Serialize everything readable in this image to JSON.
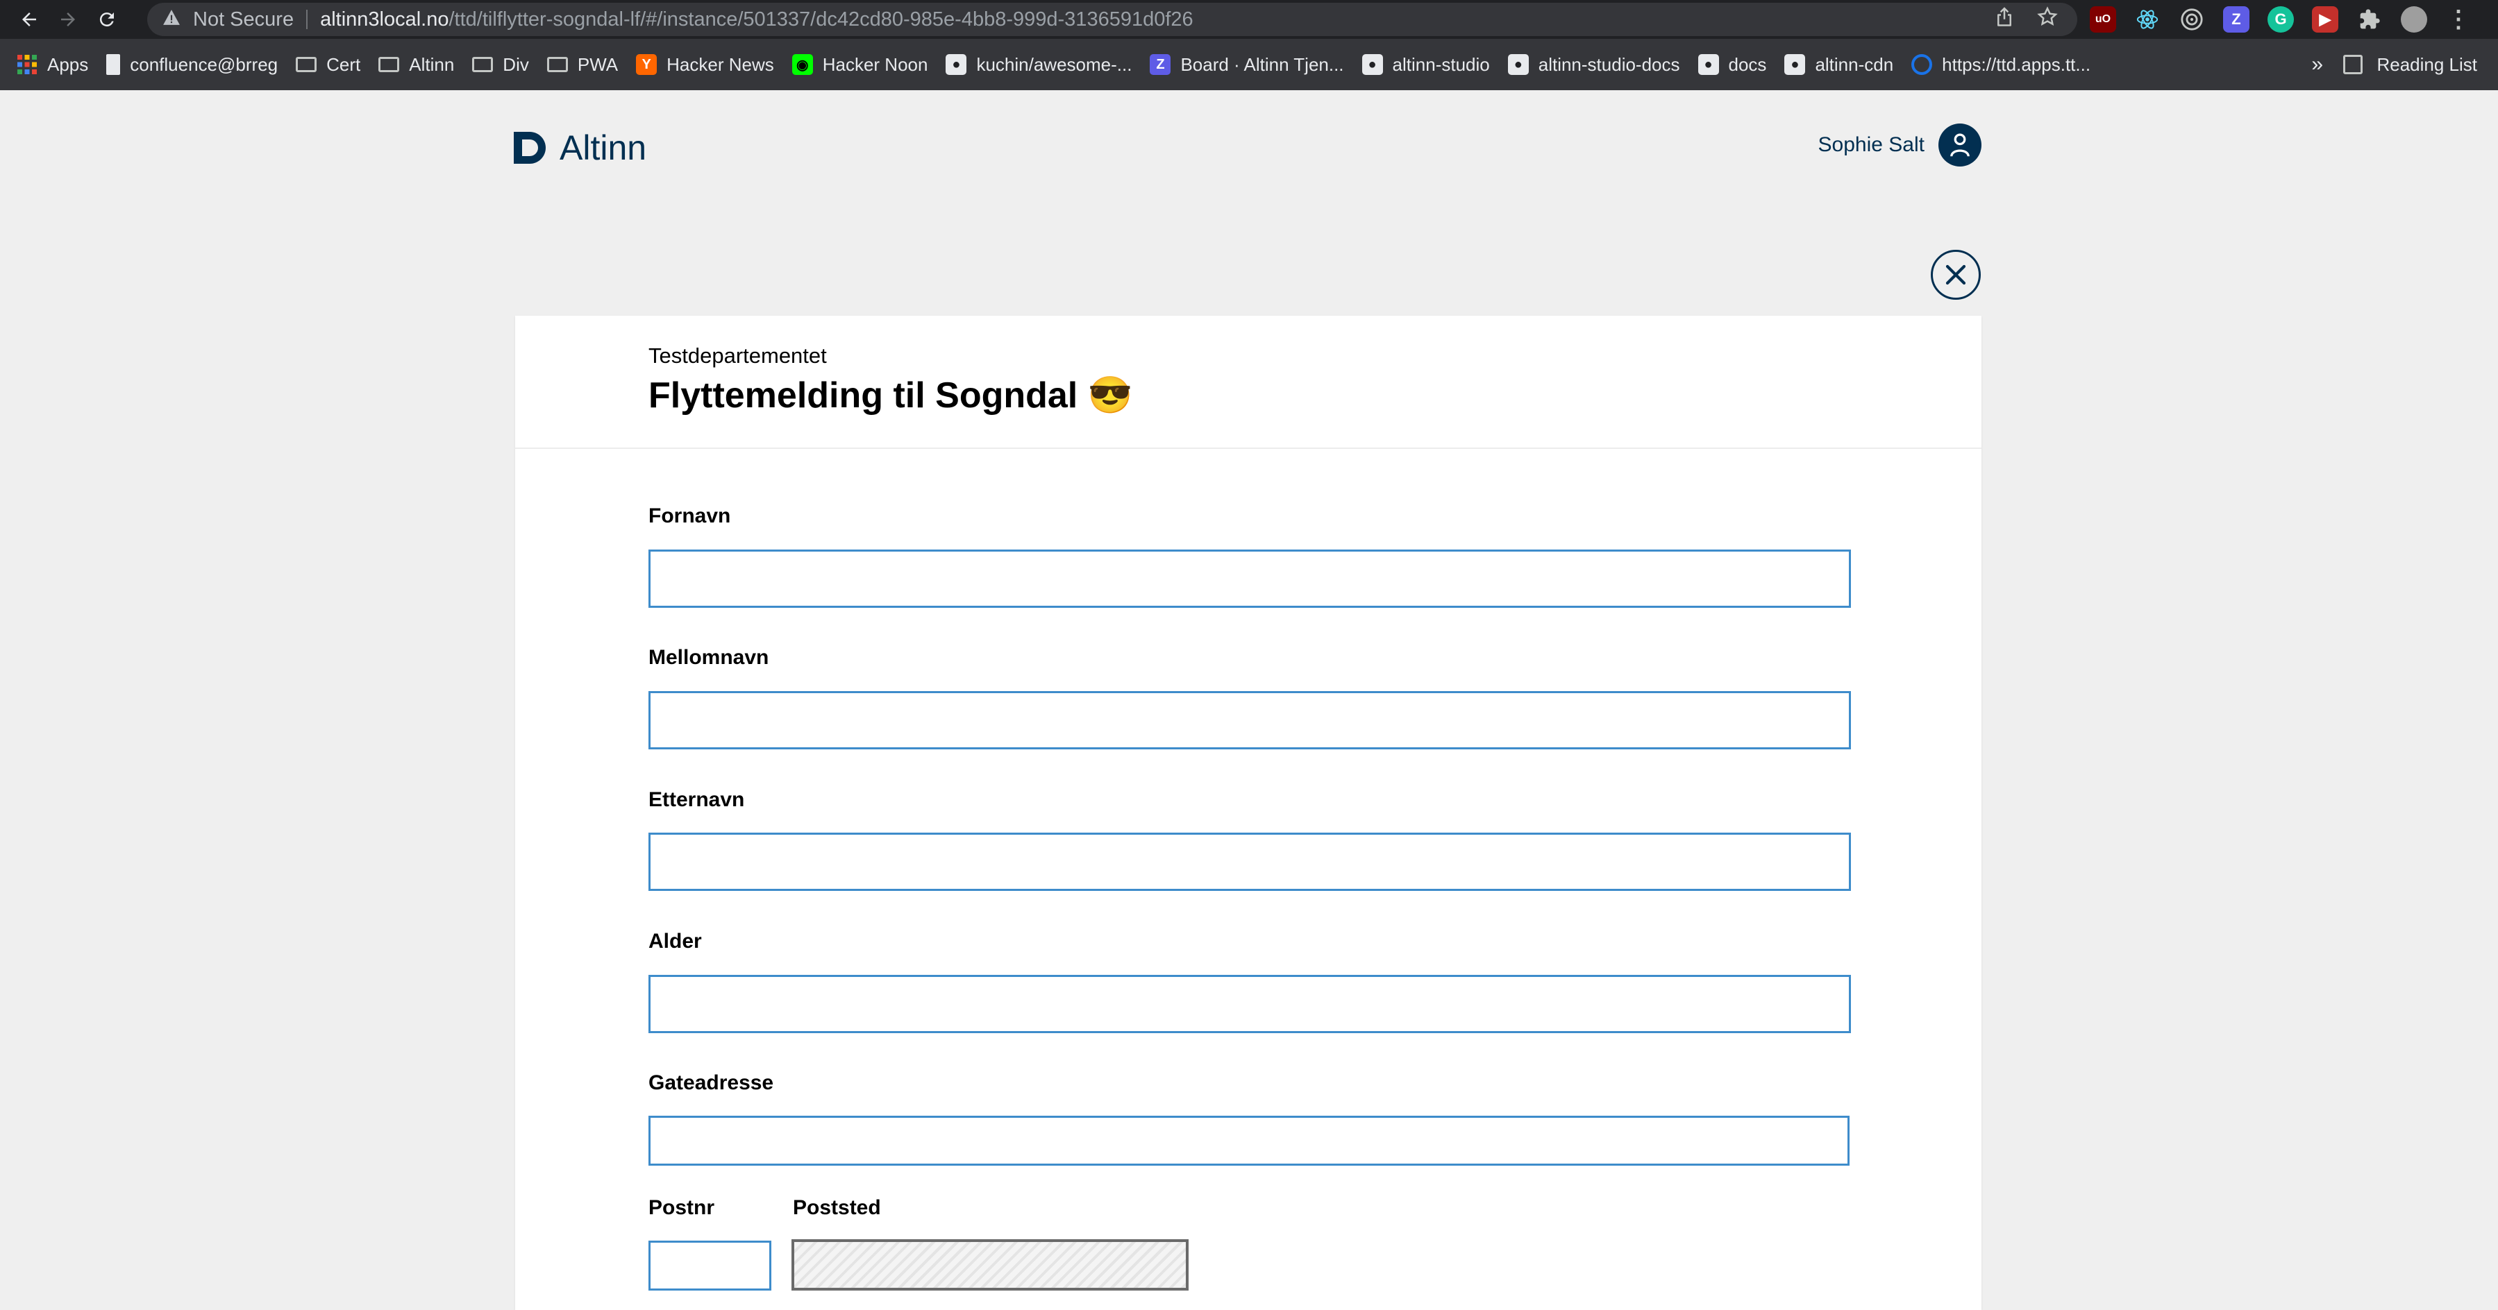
{
  "browser": {
    "security_text": "Not Secure",
    "url_host": "altinn3local.no",
    "url_path": "/ttd/tilflytter-sogndal-lf/#/instance/501337/dc42cd80-985e-4bb8-999d-3136591d0f26",
    "bookmarks": [
      {
        "label": "Apps",
        "icon": "apps-grid-icon"
      },
      {
        "label": "confluence@brreg",
        "icon": "page-icon"
      },
      {
        "label": "Cert",
        "icon": "folder-icon"
      },
      {
        "label": "Altinn",
        "icon": "folder-icon"
      },
      {
        "label": "Div",
        "icon": "folder-icon"
      },
      {
        "label": "PWA",
        "icon": "folder-icon"
      },
      {
        "label": "Hacker News",
        "icon": "hacker-news-icon"
      },
      {
        "label": "Hacker Noon",
        "icon": "hacker-noon-icon"
      },
      {
        "label": "kuchin/awesome-...",
        "icon": "github-icon"
      },
      {
        "label": "Board · Altinn Tjen...",
        "icon": "zenhub-icon"
      },
      {
        "label": "altinn-studio",
        "icon": "github-icon"
      },
      {
        "label": "altinn-studio-docs",
        "icon": "github-icon"
      },
      {
        "label": "docs",
        "icon": "github-icon"
      },
      {
        "label": "altinn-cdn",
        "icon": "github-icon"
      },
      {
        "label": "https://ttd.apps.tt...",
        "icon": "altinn-icon"
      }
    ],
    "overflow": "»",
    "reading_list": "Reading List",
    "colors": {
      "chrome_dark": "#202124",
      "toolbar": "#35363a"
    }
  },
  "header": {
    "logo_text": "Altinn",
    "user_name": "Sophie Salt"
  },
  "form": {
    "owner": "Testdepartementet",
    "title": "Flyttemelding til Sogndal 😎",
    "fields": [
      {
        "label": "Fornavn",
        "value": ""
      },
      {
        "label": "Mellomnavn",
        "value": ""
      },
      {
        "label": "Etternavn",
        "value": ""
      },
      {
        "label": "Alder",
        "value": ""
      },
      {
        "label": "Gateadresse",
        "value": ""
      }
    ],
    "postnr": {
      "label": "Postnr",
      "value": ""
    },
    "poststed": {
      "label": "Poststed",
      "value": ""
    },
    "colors": {
      "brand": "#022f51",
      "input_border": "#3e8ccb",
      "background": "#efefef"
    }
  }
}
